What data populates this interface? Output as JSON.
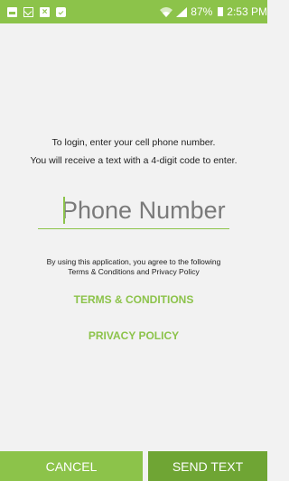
{
  "status_bar": {
    "battery": "87%",
    "time": "2:53 PM",
    "left_icons": [
      "gallery-notification-icon",
      "mail-icon",
      "close-box-icon",
      "briefcase-check-icon"
    ],
    "right_icons": [
      "wifi-icon",
      "signal-icon",
      "battery-icon"
    ]
  },
  "login": {
    "line1": "To login, enter your cell phone number.",
    "line2": "You will receive a text with a 4-digit code to enter."
  },
  "phone_input": {
    "placeholder": "Phone Number",
    "value": ""
  },
  "agreement": {
    "line1": "By using this application, you agree to the following",
    "line2": "Terms & Conditions and Privacy Policy"
  },
  "links": {
    "terms": "TERMS & CONDITIONS",
    "privacy": "PRIVACY POLICY"
  },
  "buttons": {
    "cancel": "CANCEL",
    "send": "SEND TEXT"
  },
  "colors": {
    "accent": "#8cc34a",
    "accent_dark": "#6fa534",
    "background": "#f2f2f2"
  }
}
